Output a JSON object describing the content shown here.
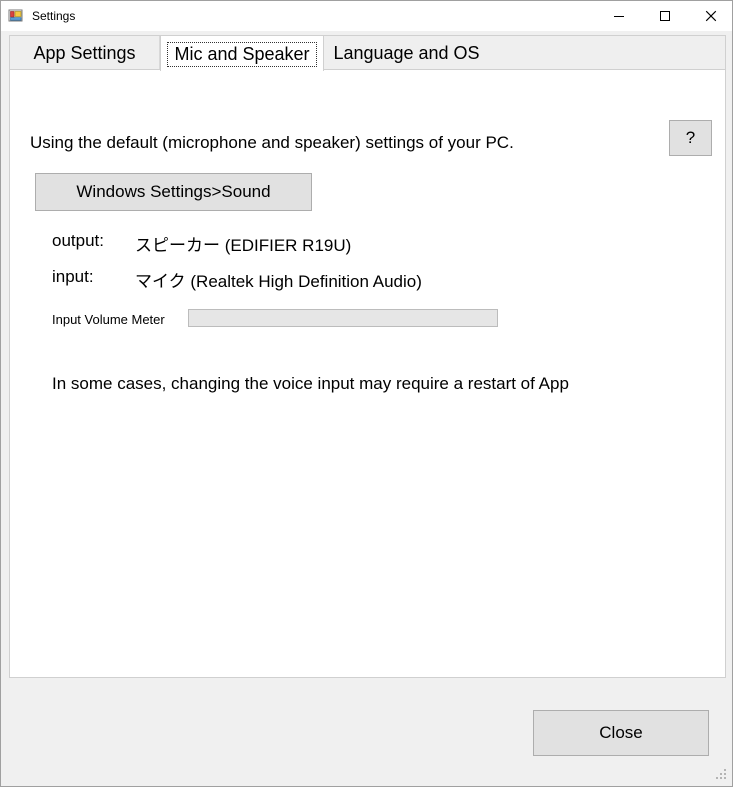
{
  "window": {
    "title": "Settings",
    "icon": "settings-app-icon",
    "controls": {
      "minimize": "minimize-icon",
      "maximize": "maximize-icon",
      "close": "close-icon"
    }
  },
  "tabs": [
    {
      "label": "App Settings",
      "active": false
    },
    {
      "label": "Mic and Speaker",
      "active": true
    },
    {
      "label": "Language and OS",
      "active": false
    }
  ],
  "content": {
    "intro": "Using the default (microphone and speaker) settings of your PC.",
    "help_label": "?",
    "sound_button": "Windows Settings>Sound",
    "output": {
      "label": "output:",
      "value": "スピーカー (EDIFIER R19U)"
    },
    "input": {
      "label": "input:",
      "value": "マイク (Realtek High Definition Audio)"
    },
    "meter": {
      "label": "Input Volume Meter",
      "value": 0,
      "max": 100,
      "fill_color": "#06b025"
    },
    "restart_note": "In some cases, changing the voice input may require a restart of App"
  },
  "footer": {
    "close_label": "Close"
  },
  "colors": {
    "window_background": "#f0f0f0",
    "panel_background": "#ffffff",
    "tabstrip_background": "#efefef",
    "button_face": "#e1e1e1",
    "button_border": "#adadad",
    "text": "#000000"
  }
}
